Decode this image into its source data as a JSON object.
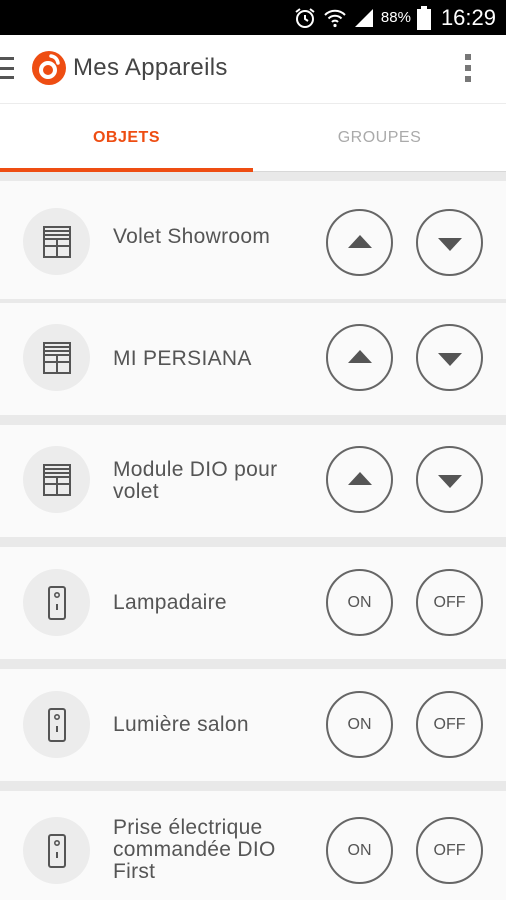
{
  "status_bar": {
    "battery_text": "88%",
    "time": "16:29",
    "icons": [
      "alarm-icon",
      "wifi-icon",
      "signal-icon",
      "battery-icon"
    ]
  },
  "app_bar": {
    "title": "Mes Appareils",
    "accent_color": "#ee4d12"
  },
  "tabs": [
    {
      "label": "OBJETS",
      "active": true
    },
    {
      "label": "GROUPES",
      "active": false
    }
  ],
  "devices": [
    {
      "name": "Volet Showroom",
      "icon": "shutter-icon",
      "controls": [
        "up",
        "down"
      ]
    },
    {
      "name": "MI PERSIANA",
      "icon": "shutter-icon",
      "controls": [
        "up",
        "down"
      ]
    },
    {
      "name": "Module DIO pour volet",
      "icon": "shutter-icon",
      "controls": [
        "up",
        "down"
      ]
    },
    {
      "name": "Lampadaire",
      "icon": "switch-icon",
      "controls": [
        "ON",
        "OFF"
      ]
    },
    {
      "name": "Lumière salon",
      "icon": "switch-icon",
      "controls": [
        "ON",
        "OFF"
      ]
    },
    {
      "name": "Prise électrique commandée DIO First",
      "icon": "switch-icon",
      "controls": [
        "ON",
        "OFF"
      ]
    }
  ]
}
